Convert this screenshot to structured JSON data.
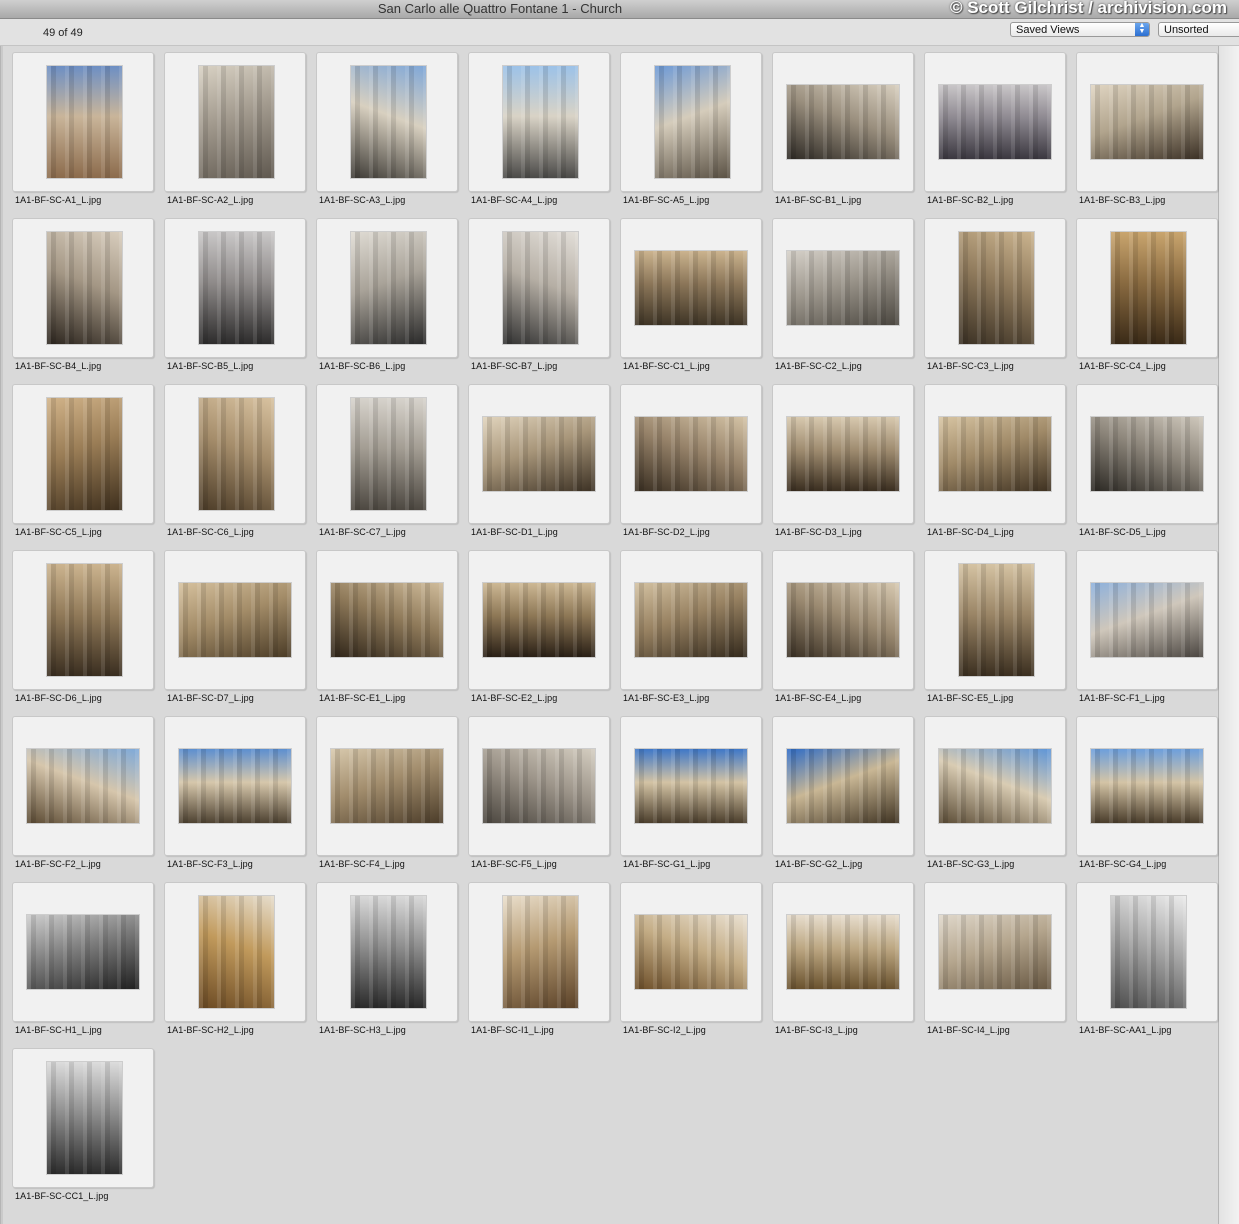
{
  "window": {
    "title": "San Carlo alle Quattro Fontane 1 - Church",
    "watermark": "© Scott Gilchrist / archivision.com"
  },
  "toolbar": {
    "count": "49 of 49",
    "saved_views": "Saved Views",
    "sort": "Unsorted"
  },
  "thumbnails": [
    {
      "name": "1A1-BF-SC-A1_L.jpg",
      "orientation": "portrait",
      "palette": [
        "#6d8fc4",
        "#c9b59a",
        "#8c6b4c"
      ]
    },
    {
      "name": "1A1-BF-SC-A2_L.jpg",
      "orientation": "portrait",
      "palette": [
        "#d9d2c4",
        "#a29a8e",
        "#5f584f"
      ]
    },
    {
      "name": "1A1-BF-SC-A3_L.jpg",
      "orientation": "portrait",
      "palette": [
        "#7fa7d8",
        "#d8d0c0",
        "#3e3b36"
      ]
    },
    {
      "name": "1A1-BF-SC-A4_L.jpg",
      "orientation": "portrait",
      "palette": [
        "#9cc2e8",
        "#d9d3c6",
        "#4b4a48"
      ]
    },
    {
      "name": "1A1-BF-SC-A5_L.jpg",
      "orientation": "portrait",
      "palette": [
        "#6e9ad6",
        "#d5ccbb",
        "#5a5144"
      ]
    },
    {
      "name": "1A1-BF-SC-B1_L.jpg",
      "orientation": "landscape",
      "palette": [
        "#d8cfbf",
        "#9a8f7e",
        "#2e2a25"
      ]
    },
    {
      "name": "1A1-BF-SC-B2_L.jpg",
      "orientation": "landscape",
      "palette": [
        "#c9c6c8",
        "#8d8890",
        "#3b3840"
      ]
    },
    {
      "name": "1A1-BF-SC-B3_L.jpg",
      "orientation": "landscape",
      "palette": [
        "#e0d5c2",
        "#b1a48d",
        "#3a2f24"
      ]
    },
    {
      "name": "1A1-BF-SC-B4_L.jpg",
      "orientation": "portrait",
      "palette": [
        "#d8cdbd",
        "#a49785",
        "#2d261f"
      ]
    },
    {
      "name": "1A1-BF-SC-B5_L.jpg",
      "orientation": "portrait",
      "palette": [
        "#c9c7c7",
        "#8f8b8a",
        "#2d2c2c"
      ]
    },
    {
      "name": "1A1-BF-SC-B6_L.jpg",
      "orientation": "portrait",
      "palette": [
        "#e0dcd4",
        "#a9a399",
        "#2a2a2a"
      ]
    },
    {
      "name": "1A1-BF-SC-B7_L.jpg",
      "orientation": "portrait",
      "palette": [
        "#e2ded8",
        "#b6afa5",
        "#333"
      ]
    },
    {
      "name": "1A1-BF-SC-C1_L.jpg",
      "orientation": "landscape",
      "palette": [
        "#cbb38e",
        "#8a7558",
        "#3f3526"
      ]
    },
    {
      "name": "1A1-BF-SC-C2_L.jpg",
      "orientation": "landscape",
      "palette": [
        "#d6d1c9",
        "#9c968c",
        "#4a463f"
      ]
    },
    {
      "name": "1A1-BF-SC-C3_L.jpg",
      "orientation": "portrait",
      "palette": [
        "#cbb48f",
        "#8f7a5c",
        "#3b3124"
      ]
    },
    {
      "name": "1A1-BF-SC-C4_L.jpg",
      "orientation": "portrait",
      "palette": [
        "#c9a56e",
        "#8a6b41",
        "#3a2a17"
      ]
    },
    {
      "name": "1A1-BF-SC-C5_L.jpg",
      "orientation": "portrait",
      "palette": [
        "#d2b48a",
        "#9a7d56",
        "#3e2f1d"
      ]
    },
    {
      "name": "1A1-BF-SC-C6_L.jpg",
      "orientation": "portrait",
      "palette": [
        "#d8c2a0",
        "#a58d6b",
        "#4c3c28"
      ]
    },
    {
      "name": "1A1-BF-SC-C7_L.jpg",
      "orientation": "portrait",
      "palette": [
        "#d7d3cc",
        "#a39d93",
        "#4d4841"
      ]
    },
    {
      "name": "1A1-BF-SC-D1_L.jpg",
      "orientation": "landscape",
      "palette": [
        "#e1d4bd",
        "#a8967a",
        "#3c3124"
      ]
    },
    {
      "name": "1A1-BF-SC-D2_L.jpg",
      "orientation": "landscape",
      "palette": [
        "#d4c3a6",
        "#97836a",
        "#3a2f22"
      ]
    },
    {
      "name": "1A1-BF-SC-D3_L.jpg",
      "orientation": "landscape",
      "palette": [
        "#d7c8ae",
        "#9e8b6f",
        "#3a2e20"
      ]
    },
    {
      "name": "1A1-BF-SC-D4_L.jpg",
      "orientation": "landscape",
      "palette": [
        "#d8c5a3",
        "#a08a68",
        "#3d3020"
      ]
    },
    {
      "name": "1A1-BF-SC-D5_L.jpg",
      "orientation": "landscape",
      "palette": [
        "#cfc8bc",
        "#8c857a",
        "#2c2924"
      ]
    },
    {
      "name": "1A1-BF-SC-D6_L.jpg",
      "orientation": "portrait",
      "palette": [
        "#ccb48f",
        "#917a59",
        "#3a2e20"
      ]
    },
    {
      "name": "1A1-BF-SC-D7_L.jpg",
      "orientation": "landscape",
      "palette": [
        "#d6c19e",
        "#a38c68",
        "#4a3b26"
      ]
    },
    {
      "name": "1A1-BF-SC-E1_L.jpg",
      "orientation": "landscape",
      "palette": [
        "#d0bc9b",
        "#8f7a5a",
        "#2f2519"
      ]
    },
    {
      "name": "1A1-BF-SC-E2_L.jpg",
      "orientation": "landscape",
      "palette": [
        "#cdb894",
        "#8c7655",
        "#2a2016"
      ]
    },
    {
      "name": "1A1-BF-SC-E3_L.jpg",
      "orientation": "landscape",
      "palette": [
        "#d3c1a1",
        "#988262",
        "#33291c"
      ]
    },
    {
      "name": "1A1-BF-SC-E4_L.jpg",
      "orientation": "landscape",
      "palette": [
        "#d7c9b1",
        "#9c8b72",
        "#3a3024"
      ]
    },
    {
      "name": "1A1-BF-SC-E5_L.jpg",
      "orientation": "portrait",
      "palette": [
        "#d5c3a3",
        "#9a8566",
        "#3b2f20"
      ]
    },
    {
      "name": "1A1-BF-SC-F1_L.jpg",
      "orientation": "landscape",
      "palette": [
        "#8eb1dc",
        "#cfc7bb",
        "#4a4540"
      ]
    },
    {
      "name": "1A1-BF-SC-F2_L.jpg",
      "orientation": "landscape",
      "palette": [
        "#7ea9d9",
        "#d6c6ac",
        "#5b4a33"
      ]
    },
    {
      "name": "1A1-BF-SC-F3_L.jpg",
      "orientation": "landscape",
      "palette": [
        "#5d8fd0",
        "#d6c7ab",
        "#4e4231"
      ]
    },
    {
      "name": "1A1-BF-SC-F4_L.jpg",
      "orientation": "landscape",
      "palette": [
        "#d8c9ad",
        "#a28d6d",
        "#4b3c29"
      ]
    },
    {
      "name": "1A1-BF-SC-F5_L.jpg",
      "orientation": "landscape",
      "palette": [
        "#d4cdc0",
        "#9d958a",
        "#4c4740"
      ]
    },
    {
      "name": "1A1-BF-SC-G1_L.jpg",
      "orientation": "landscape",
      "palette": [
        "#3f78c8",
        "#d3c3a4",
        "#4c3f2d"
      ]
    },
    {
      "name": "1A1-BF-SC-G2_L.jpg",
      "orientation": "landscape",
      "palette": [
        "#2f6cc6",
        "#c9b795",
        "#3f3322"
      ]
    },
    {
      "name": "1A1-BF-SC-G3_L.jpg",
      "orientation": "landscape",
      "palette": [
        "#5d95d8",
        "#d9ccb3",
        "#5b4c36"
      ]
    },
    {
      "name": "1A1-BF-SC-G4_L.jpg",
      "orientation": "landscape",
      "palette": [
        "#6d9fdc",
        "#d4c4a6",
        "#4a3d2b"
      ]
    },
    {
      "name": "1A1-BF-SC-H1_L.jpg",
      "orientation": "landscape",
      "palette": [
        "#cfcfcf",
        "#7d7d7d",
        "#1f1f1f"
      ],
      "bw": true
    },
    {
      "name": "1A1-BF-SC-H2_L.jpg",
      "orientation": "portrait",
      "palette": [
        "#e6ddcc",
        "#c19a5c",
        "#6b4a24"
      ]
    },
    {
      "name": "1A1-BF-SC-H3_L.jpg",
      "orientation": "portrait",
      "palette": [
        "#d9d9d9",
        "#8e8e8e",
        "#2a2a2a"
      ],
      "bw": true
    },
    {
      "name": "1A1-BF-SC-I1_L.jpg",
      "orientation": "portrait",
      "palette": [
        "#eadfcc",
        "#b59a72",
        "#5a4128"
      ]
    },
    {
      "name": "1A1-BF-SC-I2_L.jpg",
      "orientation": "landscape",
      "palette": [
        "#eae1d2",
        "#c4ad86",
        "#6d4f2a"
      ]
    },
    {
      "name": "1A1-BF-SC-I3_L.jpg",
      "orientation": "landscape",
      "palette": [
        "#e7ddcd",
        "#bca782",
        "#6a522f"
      ]
    },
    {
      "name": "1A1-BF-SC-I4_L.jpg",
      "orientation": "landscape",
      "palette": [
        "#e0d8cb",
        "#b5a68e",
        "#665641"
      ]
    },
    {
      "name": "1A1-BF-SC-AA1_L.jpg",
      "orientation": "portrait",
      "palette": [
        "#ecebe7",
        "#a9a7a2",
        "#4e4d4a"
      ],
      "bw": true
    },
    {
      "name": "1A1-BF-SC-CC1_L.jpg",
      "orientation": "portrait",
      "palette": [
        "#dcdcdc",
        "#8f8f8f",
        "#2c2c2c"
      ],
      "bw": true
    }
  ]
}
